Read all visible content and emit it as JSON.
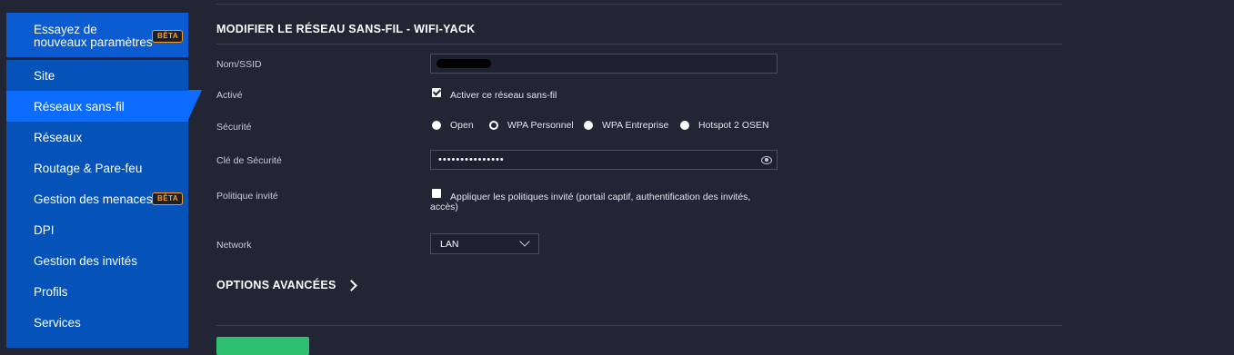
{
  "sidebar": {
    "top_item": {
      "label": "Essayez de nouveaux paramètres",
      "badge": "BÊTA"
    },
    "items": [
      {
        "label": "Site"
      },
      {
        "label": "Réseaux sans-fil",
        "active": true
      },
      {
        "label": "Réseaux"
      },
      {
        "label": "Routage & Pare-feu"
      },
      {
        "label": "Gestion des menaces",
        "badge": "BÊTA"
      },
      {
        "label": "DPI"
      },
      {
        "label": "Gestion des invités"
      },
      {
        "label": "Profils"
      },
      {
        "label": "Services"
      }
    ]
  },
  "form": {
    "title": "MODIFIER LE RÉSEAU SANS-FIL - WIFI-YACK",
    "ssid_label": "Nom/SSID",
    "enabled_label": "Activé",
    "enabled_checkbox_text": "Activer ce réseau sans-fil",
    "enabled_checked": true,
    "security_label": "Sécurité",
    "security_options": [
      "Open",
      "WPA Personnel",
      "WPA Entreprise",
      "Hotspot 2 OSEN"
    ],
    "security_selected": "WPA Personnel",
    "key_label": "Clé de Sécurité",
    "key_masked": "•••••••••••••••",
    "guest_label": "Politique invité",
    "guest_checkbox_text": "Appliquer les politiques invité (portail captif, authentification des invités,",
    "guest_checkbox_text_2": "accès)",
    "guest_checked": false,
    "network_label": "Network",
    "network_value": "LAN",
    "advanced_label": "OPTIONS AVANCÉES"
  },
  "colors": {
    "background": "#222533",
    "sidebar_blue": "#0552b8",
    "active_blue": "#0b6cff",
    "badge_orange": "#ff9f1c",
    "save_green": "#2fbf71"
  }
}
